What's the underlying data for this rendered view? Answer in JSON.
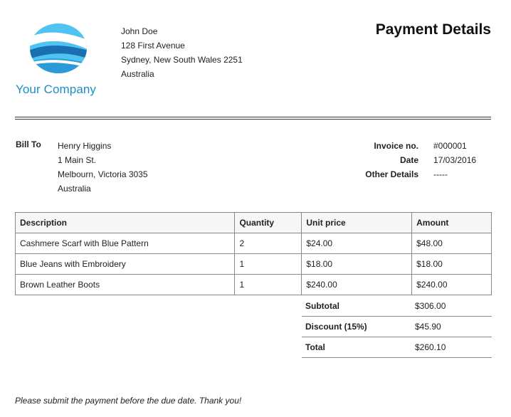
{
  "company": {
    "name": "Your Company",
    "brand_color": "#1c8dc7",
    "logo_icon": "globe-logo-icon"
  },
  "sender": {
    "name": "John Doe",
    "street": "128 First Avenue",
    "city": "Sydney, New South Wales 2251",
    "country": "Australia"
  },
  "title": "Payment Details",
  "bill_to": {
    "label": "Bill To",
    "name": "Henry Higgins",
    "street": "1 Main St.",
    "city": "Melbourn, Victoria 3035",
    "country": "Australia"
  },
  "meta": [
    {
      "label": "Invoice no.",
      "value": "#000001"
    },
    {
      "label": "Date",
      "value": "17/03/2016"
    },
    {
      "label": "Other Details",
      "value": "-----"
    }
  ],
  "table": {
    "headers": [
      "Description",
      "Quantity",
      "Unit price",
      "Amount"
    ],
    "rows": [
      [
        "Cashmere Scarf with Blue Pattern",
        "2",
        "$24.00",
        "$48.00"
      ],
      [
        "Blue Jeans with Embroidery",
        "1",
        "$18.00",
        "$18.00"
      ],
      [
        "Brown Leather Boots",
        "1",
        "$240.00",
        "$240.00"
      ]
    ]
  },
  "totals": [
    {
      "label": "Subtotal",
      "value": "$306.00"
    },
    {
      "label": "Discount (15%)",
      "value": "$45.90"
    },
    {
      "label": "Total",
      "value": "$260.10"
    }
  ],
  "footer_note": "Please submit the payment before the due date. Thank you!"
}
